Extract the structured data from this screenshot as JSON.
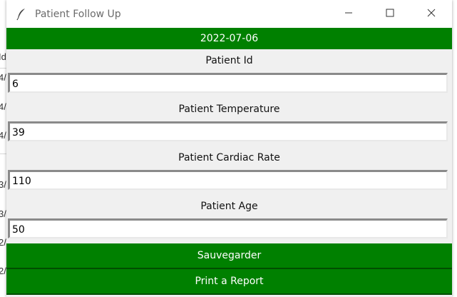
{
  "background_window": {
    "left_fragments": [
      "Id",
      "4/",
      "4/",
      "4/",
      "3/",
      "3/",
      "2/",
      "2/"
    ]
  },
  "window": {
    "title": "Patient Follow Up",
    "icon": "feather-icon",
    "controls": {
      "minimize": "minimize-icon",
      "maximize": "maximize-icon",
      "close": "close-icon"
    }
  },
  "date": "2022-07-06",
  "fields": [
    {
      "label": "Patient Id",
      "value": "6"
    },
    {
      "label": "Patient Temperature",
      "value": "39"
    },
    {
      "label": "Patient Cardiac Rate",
      "value": "110"
    },
    {
      "label": "Patient Age",
      "value": "50"
    }
  ],
  "buttons": {
    "save_label": "Sauvegarder",
    "report_label": "Print a Report"
  },
  "colors": {
    "accent": "#008000",
    "background": "#f0f0f0"
  }
}
